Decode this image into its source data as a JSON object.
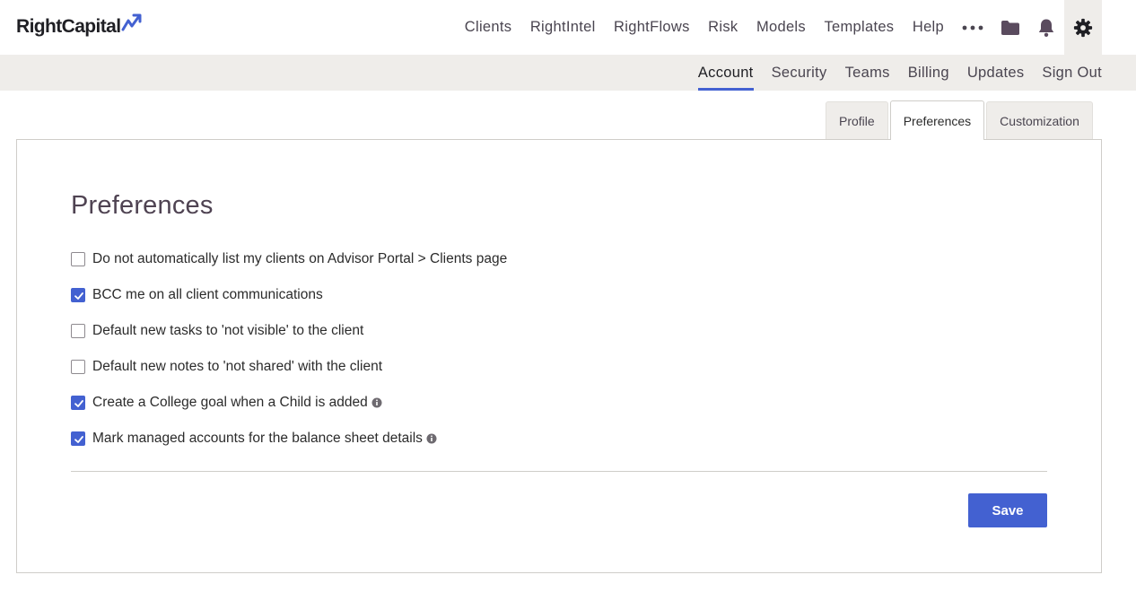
{
  "brand": {
    "name": "RightCapital",
    "logo_icon": "trend-arrow-icon",
    "accent": "#4361d1"
  },
  "topnav": {
    "items": [
      {
        "label": "Clients"
      },
      {
        "label": "RightIntel"
      },
      {
        "label": "RightFlows"
      },
      {
        "label": "Risk"
      },
      {
        "label": "Models"
      },
      {
        "label": "Templates"
      },
      {
        "label": "Help"
      }
    ],
    "more_icon": "more-dots-icon",
    "folder_icon": "folder-icon",
    "bell_icon": "bell-icon",
    "gear_icon": "gear-icon"
  },
  "subnav": {
    "items": [
      {
        "label": "Account",
        "active": true
      },
      {
        "label": "Security"
      },
      {
        "label": "Teams"
      },
      {
        "label": "Billing"
      },
      {
        "label": "Updates"
      },
      {
        "label": "Sign Out"
      }
    ]
  },
  "tabs": [
    {
      "label": "Profile"
    },
    {
      "label": "Preferences",
      "active": true
    },
    {
      "label": "Customization"
    }
  ],
  "preferences": {
    "title": "Preferences",
    "options": [
      {
        "label": "Do not automatically list my clients on Advisor Portal > Clients page",
        "checked": false
      },
      {
        "label": "BCC me on all client communications",
        "checked": true
      },
      {
        "label": "Default new tasks to 'not visible' to the client",
        "checked": false
      },
      {
        "label": "Default new notes to 'not shared' with the client",
        "checked": false
      },
      {
        "label": "Create a College goal when a Child is added",
        "checked": true,
        "info": true
      },
      {
        "label": "Mark managed accounts for the balance sheet details",
        "checked": true,
        "info": true
      }
    ],
    "save_label": "Save"
  }
}
